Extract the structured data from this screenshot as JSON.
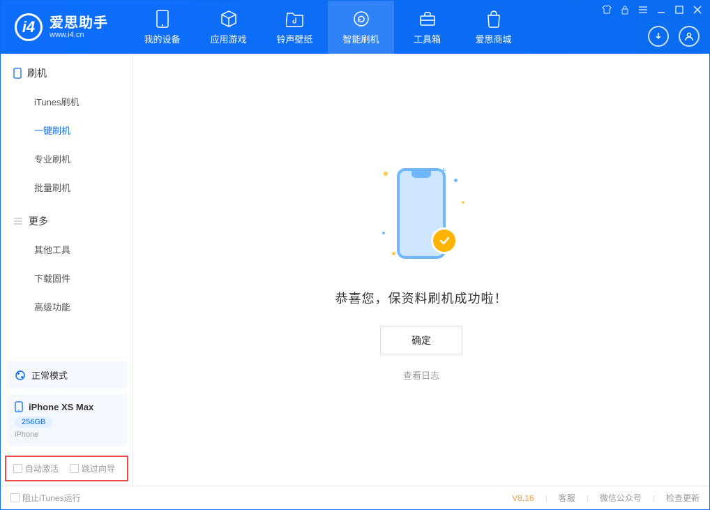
{
  "app": {
    "title": "爱思助手",
    "subtitle": "www.i4.cn"
  },
  "nav": {
    "items": [
      {
        "label": "我的设备"
      },
      {
        "label": "应用游戏"
      },
      {
        "label": "铃声壁纸"
      },
      {
        "label": "智能刷机"
      },
      {
        "label": "工具箱"
      },
      {
        "label": "爱思商城"
      }
    ],
    "active_index": 3
  },
  "sidebar": {
    "section1_title": "刷机",
    "section1_items": [
      "iTunes刷机",
      "一键刷机",
      "专业刷机",
      "批量刷机"
    ],
    "section1_active_index": 1,
    "section2_title": "更多",
    "section2_items": [
      "其他工具",
      "下载固件",
      "高级功能"
    ],
    "mode_label": "正常模式",
    "device_name": "iPhone XS Max",
    "storage": "256GB",
    "device_type": "iPhone",
    "checkbox1": "自动激活",
    "checkbox2": "跳过向导"
  },
  "main": {
    "success_msg": "恭喜您，保资料刷机成功啦！",
    "ok_label": "确定",
    "log_link": "查看日志"
  },
  "statusbar": {
    "block_itunes": "阻止iTunes运行",
    "version": "V8.16",
    "support": "客服",
    "wechat": "微信公众号",
    "check_update": "检查更新"
  }
}
